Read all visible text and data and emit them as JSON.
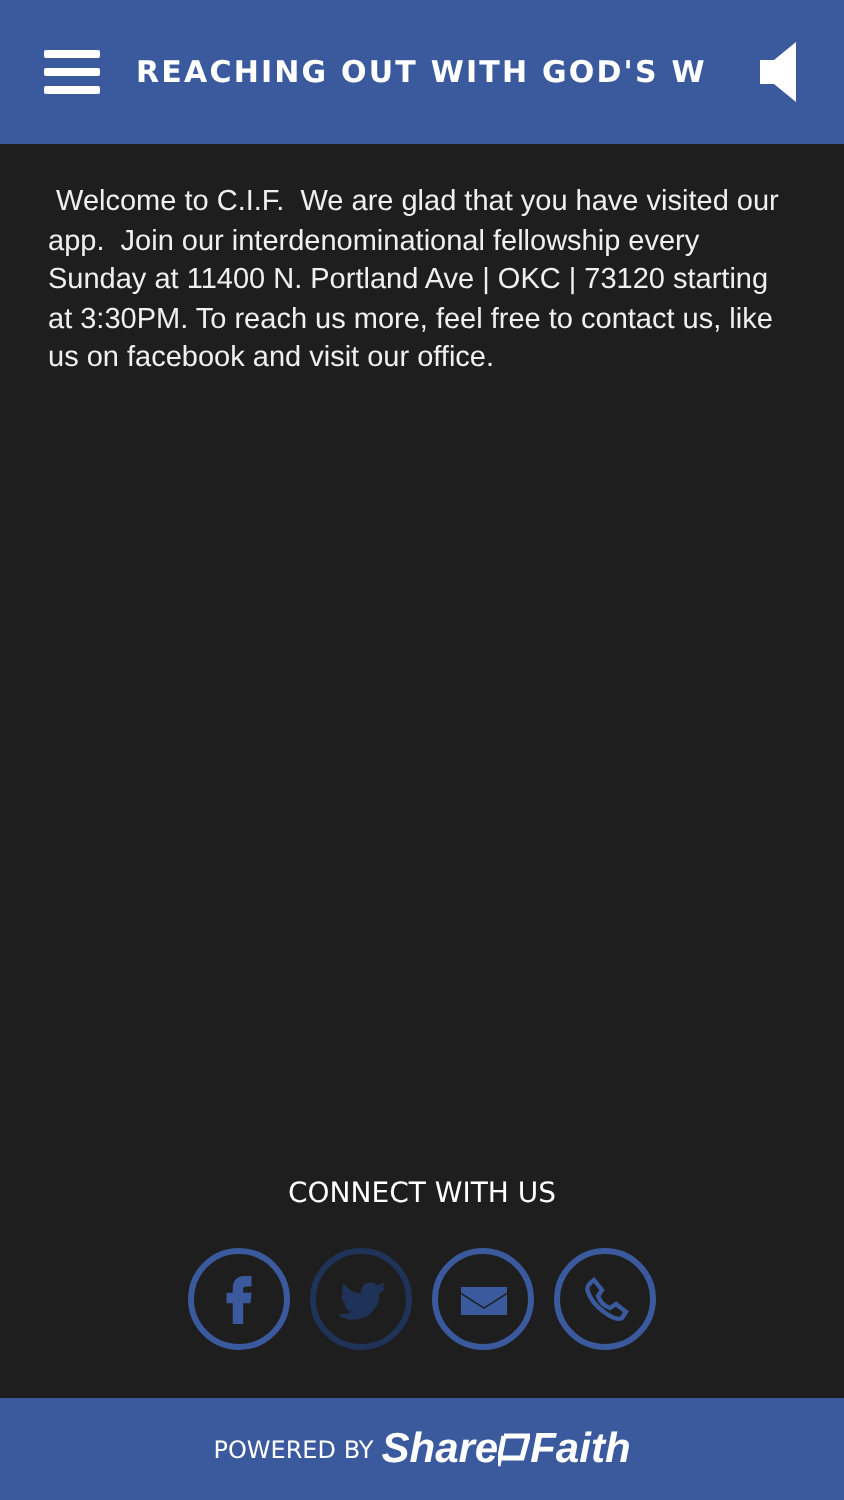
{
  "header": {
    "title": "REACHING OUT WITH GOD'S W"
  },
  "welcome_text": " Welcome to C.I.F.  We are glad that you have visited our app.  Join our interdenominational fellowship every Sunday at 11400 N. Portland Ave | OKC | 73120 starting at 3:30PM. To reach us more, feel free to contact us, like us on facebook and visit our office.",
  "connect": {
    "heading": "CONNECT WITH US",
    "links": [
      {
        "kind": "facebook",
        "disabled": false
      },
      {
        "kind": "twitter",
        "disabled": true
      },
      {
        "kind": "email",
        "disabled": false
      },
      {
        "kind": "phone",
        "disabled": false
      }
    ]
  },
  "footer": {
    "powered_by": "POWERED BY",
    "logo_parts": [
      "Share",
      "Faith"
    ]
  }
}
